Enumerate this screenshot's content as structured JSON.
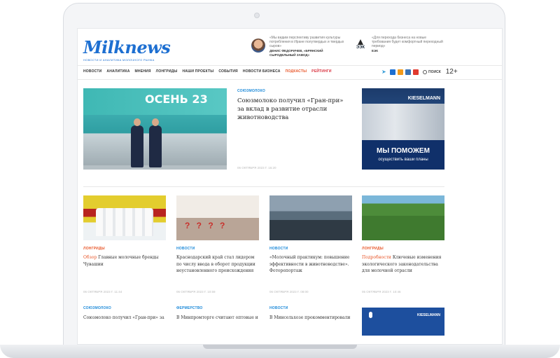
{
  "site": {
    "logo": "Milknews",
    "tagline": "новости и аналитика молочного рынка"
  },
  "header_quotes": [
    {
      "text": "«Мы видим перспективу развития культуры потребления в Иране полутвердых и твердых сыров»",
      "author": "ДЕНИС ФЕДОРИЧЕВ, «БРЯНСКИЙ СЫРОДЕЛЬНЫЙ ЗАВОД»"
    },
    {
      "logo_text": "ЭЭК",
      "text": "«Для перехода бизнеса на новые требования будет комфортный переходный период»",
      "author": "ЕЭК"
    }
  ],
  "nav": [
    "НОВОСТИ",
    "АНАЛИТИКА",
    "МНЕНИЯ",
    "ЛОНГРИДЫ",
    "НАШИ ПРОЕКТЫ",
    "СОБЫТИЯ",
    "НОВОСТИ БИЗНЕСА",
    "ПОДКАСТЫ",
    "РЕЙТИНГИ"
  ],
  "search_label": "ПОИСК",
  "age_rating": "12+",
  "featured": {
    "banner": "ОСЕНЬ 23",
    "category": "СОЮЗМОЛОКО",
    "title": "Союзмолоко получил «Гран-при» за вклад в развитие отрасли животноводства",
    "date": "06 ОКТЯБРЯ 2023 Г. 16:20"
  },
  "ad": {
    "brand": "KIESELMANN",
    "headline": "МЫ ПОМОЖЕМ",
    "subline": "осуществить ваши планы"
  },
  "cards": [
    {
      "category": "ЛОНГРИДЫ",
      "accent": "Обзор",
      "title": "Главные молочные бренды Чувашии",
      "date": "06 ОКТЯБРЯ 2023 Г. 11:44"
    },
    {
      "category": "НОВОСТИ",
      "accent": "",
      "title": "Краснодарский край стал лидером по числу ввода в оборот продукции неустановленного происхождения",
      "date": "06 ОКТЯБРЯ 2023 Г. 10:59"
    },
    {
      "category": "НОВОСТИ",
      "accent": "",
      "title": "«Молочный практикум: повышение эффективности в животноводстве». Фоторепортаж",
      "date": "06 ОКТЯБРЯ 2023 Г. 08:00"
    },
    {
      "category": "ЛОНГРИДЫ",
      "accent": "Подробности",
      "title": "Ключевые изменения экологического законодательства для молочной отрасли",
      "date": "05 ОКТЯБРЯ 2023 Г. 10:46"
    }
  ],
  "row2": [
    {
      "category": "СОЮЗМОЛОКО",
      "title": "Союзмолоко получил «Гран-при» за"
    },
    {
      "category": "ФЕРМЕРСТВО",
      "title": "В Минпромторге считают оптовые и"
    },
    {
      "category": "НОВОСТИ",
      "title": "В Минсельхозе прокомментировали"
    }
  ],
  "row2_ad_brand": "KIESELMANN"
}
